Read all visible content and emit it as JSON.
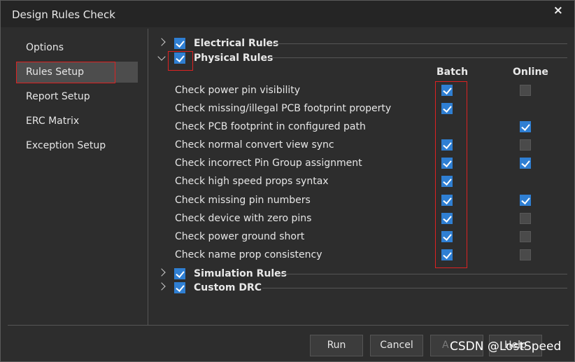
{
  "window": {
    "title": "Design Rules Check",
    "close_glyph": "×"
  },
  "sidebar": {
    "items": [
      {
        "label": "Options"
      },
      {
        "label": "Rules Setup"
      },
      {
        "label": "Report Setup"
      },
      {
        "label": "ERC Matrix"
      },
      {
        "label": "Exception Setup"
      }
    ],
    "selected": "Rules Setup"
  },
  "sections": {
    "electrical": {
      "label": "Electrical Rules",
      "checked": true,
      "expanded": false
    },
    "physical": {
      "label": "Physical Rules",
      "checked": true,
      "expanded": true
    },
    "simulation": {
      "label": "Simulation Rules",
      "checked": true,
      "expanded": false
    },
    "custom": {
      "label": "Custom DRC",
      "checked": true,
      "expanded": false
    }
  },
  "columns": {
    "batch": "Batch",
    "online": "Online"
  },
  "rules": [
    {
      "label": "Check power pin visibility",
      "batch": true,
      "online": false
    },
    {
      "label": "Check missing/illegal PCB footprint property",
      "batch": true,
      "online": null
    },
    {
      "label": "Check PCB footprint in configured path",
      "batch": null,
      "online": true
    },
    {
      "label": "Check normal convert view sync",
      "batch": true,
      "online": false
    },
    {
      "label": "Check incorrect Pin Group assignment",
      "batch": true,
      "online": true
    },
    {
      "label": "Check high speed props syntax",
      "batch": true,
      "online": null
    },
    {
      "label": "Check missing pin numbers",
      "batch": true,
      "online": true
    },
    {
      "label": "Check device with zero pins",
      "batch": true,
      "online": false
    },
    {
      "label": "Check power ground short",
      "batch": true,
      "online": false
    },
    {
      "label": "Check name prop consistency",
      "batch": true,
      "online": false
    }
  ],
  "buttons": {
    "run": "Run",
    "cancel": "Cancel",
    "apply": "A",
    "help": "Help"
  },
  "watermark": "CSDN @LostSpeed",
  "colors": {
    "accent": "#2f7fd3",
    "highlight": "#dd2222",
    "background": "#2d2d2d"
  }
}
